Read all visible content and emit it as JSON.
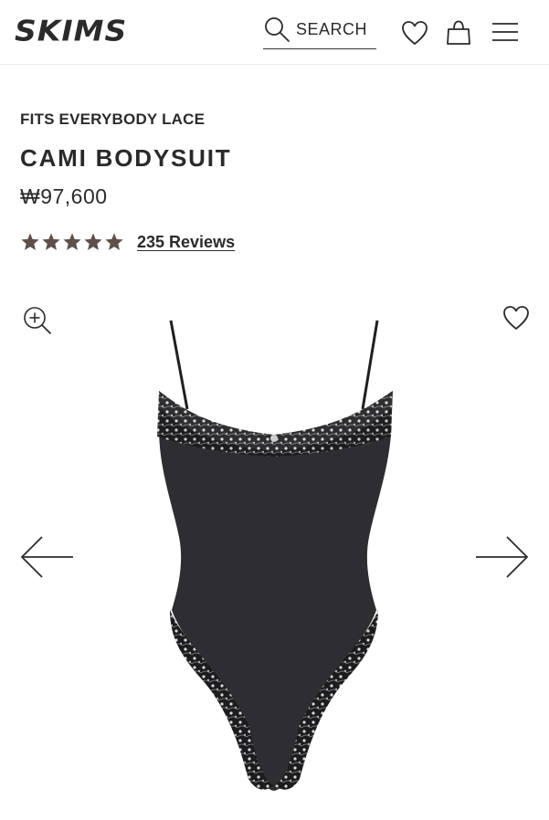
{
  "header": {
    "logo": "SKIMS",
    "search_label": "SEARCH",
    "icons": {
      "search": "search-icon",
      "wishlist": "heart-icon",
      "bag": "shopping-bag-icon",
      "menu": "hamburger-menu-icon"
    }
  },
  "product": {
    "collection": "FITS EVERYBODY LACE",
    "name": "CAMI BODYSUIT",
    "price": "₩97,600",
    "rating": {
      "stars": 5,
      "max": 5,
      "reviews_label": "235 Reviews"
    },
    "image_alt": "Black cami bodysuit with lace trim"
  },
  "colors": {
    "text": "#2b2b2b",
    "star": "#5e5049",
    "product_fabric": "#2e2d31",
    "lace": "#1c1b1d"
  }
}
